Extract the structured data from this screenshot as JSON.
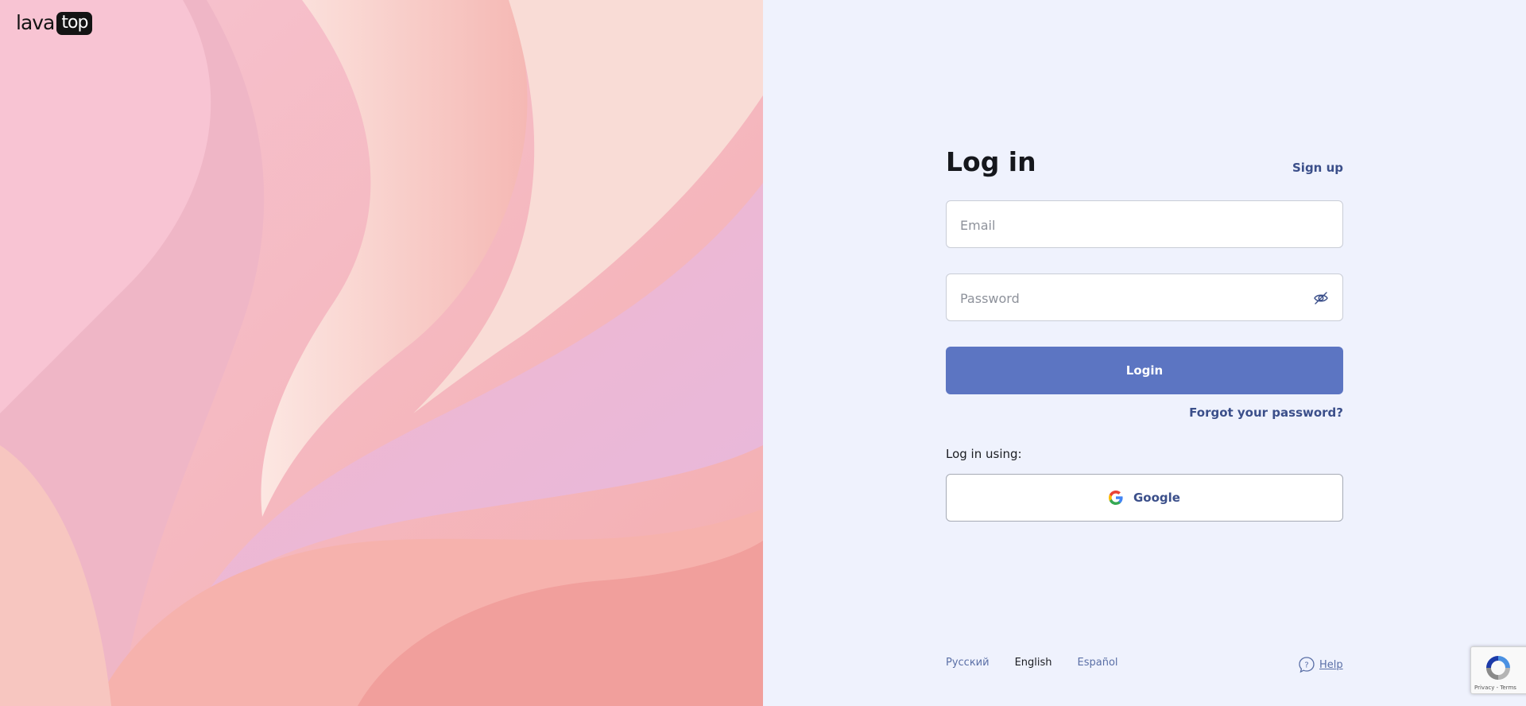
{
  "brand": {
    "logo_left": "lava",
    "logo_right": "top"
  },
  "form": {
    "title": "Log in",
    "signup_link": "Sign up",
    "email_placeholder": "Email",
    "password_placeholder": "Password",
    "login_button": "Login",
    "forgot_link": "Forgot your password?",
    "social_label": "Log in using:",
    "google_button": "Google"
  },
  "footer": {
    "languages": [
      {
        "label": "Русский",
        "active": false
      },
      {
        "label": "English",
        "active": true
      },
      {
        "label": "Español",
        "active": false
      }
    ],
    "help_label": "Help"
  },
  "recaptcha": {
    "footer_text": "Privacy - Terms"
  },
  "icons": {
    "eye": "eye-off-icon",
    "google": "google-g-icon",
    "help": "help-question-icon",
    "recaptcha": "recaptcha-icon"
  },
  "colors": {
    "primary_button": "#5c75c2",
    "link": "#3b4f8a",
    "panel_bg": "#eff2fd"
  }
}
